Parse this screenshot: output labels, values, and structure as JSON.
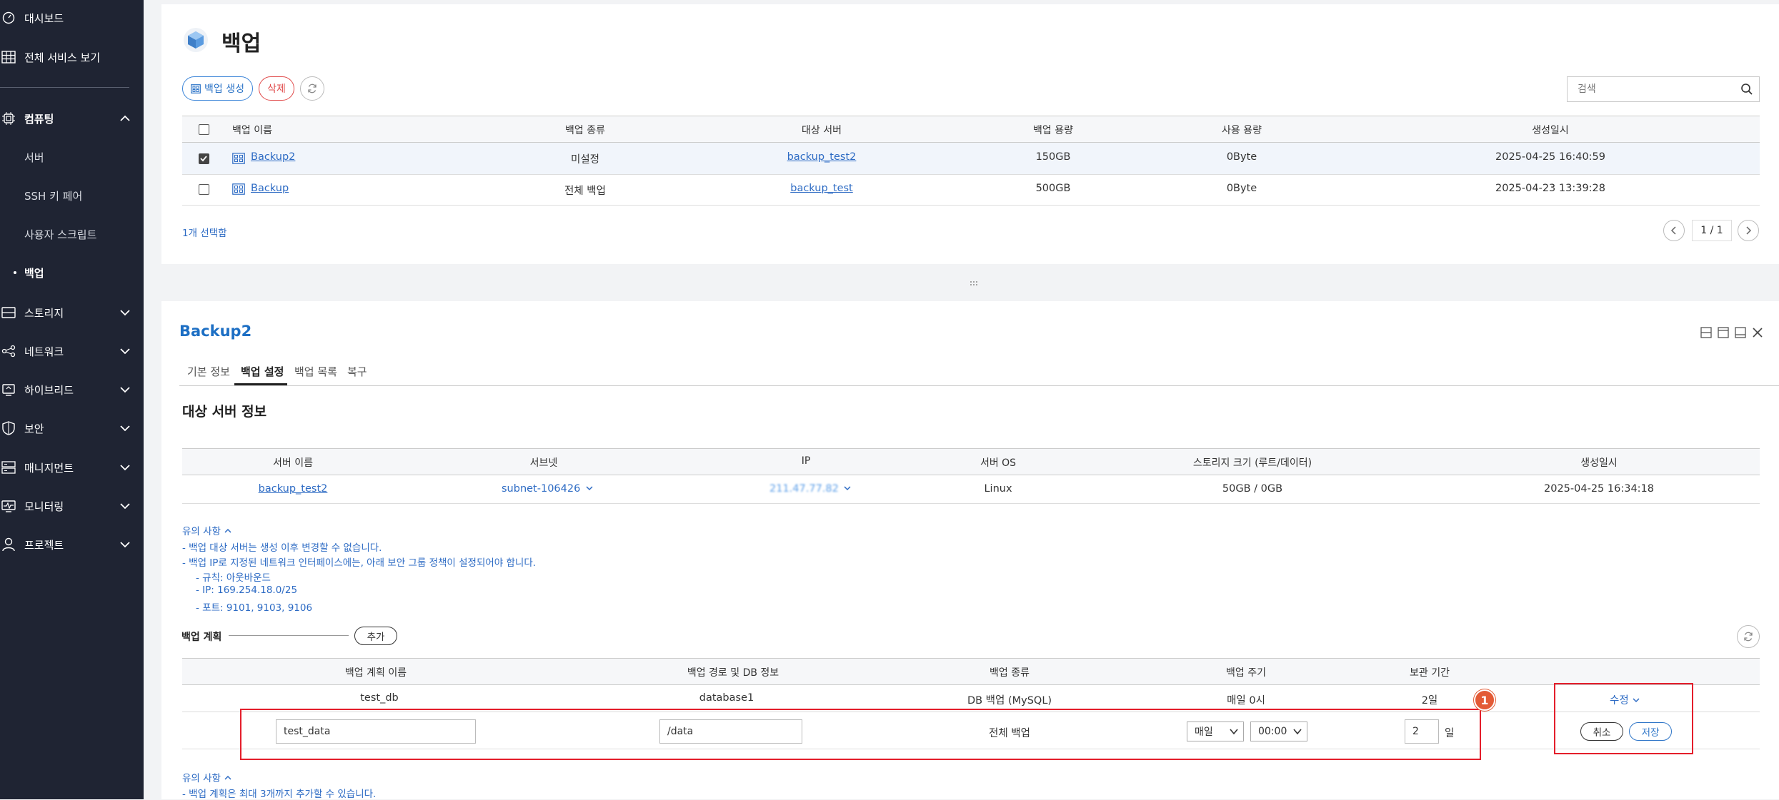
{
  "sidebar": {
    "items": [
      {
        "label": "대시보드",
        "icon": "dashboard-icon"
      },
      {
        "label": "전체 서비스 보기",
        "icon": "grid-icon"
      },
      {
        "label": "컴퓨팅",
        "icon": "cpu-icon",
        "expanded": true
      },
      {
        "label": "스토리지",
        "icon": "storage-icon"
      },
      {
        "label": "네트워크",
        "icon": "network-icon"
      },
      {
        "label": "하이브리드",
        "icon": "hybrid-icon"
      },
      {
        "label": "보안",
        "icon": "shield-icon"
      },
      {
        "label": "매니지먼트",
        "icon": "management-icon"
      },
      {
        "label": "모니터링",
        "icon": "monitor-icon"
      },
      {
        "label": "프로젝트",
        "icon": "user-icon"
      }
    ],
    "sub_items": [
      "서버",
      "SSH 키 페어",
      "사용자 스크립트",
      "백업"
    ],
    "active_sub": "백업"
  },
  "header": {
    "title": "백업",
    "create_label": "백업 생성",
    "delete_label": "삭제",
    "search_placeholder": "검색"
  },
  "backup_table": {
    "columns": [
      "백업 이름",
      "백업 종류",
      "대상 서버",
      "백업 용량",
      "사용 용량",
      "생성일시"
    ],
    "rows": [
      {
        "name": "Backup2",
        "type": "미설정",
        "server": "backup_test2",
        "size": "150GB",
        "used": "0Byte",
        "created": "2025-04-25 16:40:59",
        "checked": true
      },
      {
        "name": "Backup",
        "type": "전체 백업",
        "server": "backup_test",
        "size": "500GB",
        "used": "0Byte",
        "created": "2025-04-23 13:39:28",
        "checked": false
      }
    ],
    "selected_text": "1개 선택함",
    "pager": "1 / 1"
  },
  "detail": {
    "title": "Backup2",
    "tabs": [
      "기본 정보",
      "백업 설정",
      "백업 목록",
      "복구"
    ],
    "active_tab": "백업 설정",
    "section_title": "대상 서버 정보",
    "server_columns": [
      "서버 이름",
      "서브넷",
      "IP",
      "서버 OS",
      "스토리지 크기 (루트/데이터)",
      "생성일시"
    ],
    "server_row": {
      "name": "backup_test2",
      "subnet": "subnet-106426",
      "ip": "211.47.77.82",
      "os": "Linux",
      "storage": "50GB / 0GB",
      "created": "2025-04-25 16:34:18"
    },
    "notice": {
      "head": "유의 사항",
      "lines": [
        "- 백업 대상 서버는 생성 이후 변경할 수 없습니다.",
        "- 백업 IP로 지정된 네트워크 인터페이스에는, 아래 보안 그룹 정책이 설정되어야 합니다.",
        "- 규칙: 아웃바운드",
        "- IP: 169.254.18.0/25",
        "- 포트: 9101, 9103, 9106"
      ]
    },
    "plan": {
      "label": "백업 계획",
      "add_label": "추가",
      "columns": [
        "백업 계획 이름",
        "백업 경로 및 DB 정보",
        "백업 종류",
        "백업 주기",
        "보관 기간"
      ],
      "row": {
        "name": "test_db",
        "path": "database1",
        "type": "DB 백업 (MySQL)",
        "cycle": "매일 0시",
        "retention": "2일",
        "edit_label": "수정"
      },
      "edit_row": {
        "name": "test_data",
        "path": "/data",
        "type": "전체 백업",
        "cycle": "매일",
        "time": "00:00",
        "retention": "2",
        "unit": "일",
        "cancel_label": "취소",
        "save_label": "저장"
      },
      "badge": "1"
    },
    "notice2": {
      "head": "유의 사항",
      "line": "- 백업 계획은 최대 3개까지 추가할 수 있습니다."
    }
  }
}
